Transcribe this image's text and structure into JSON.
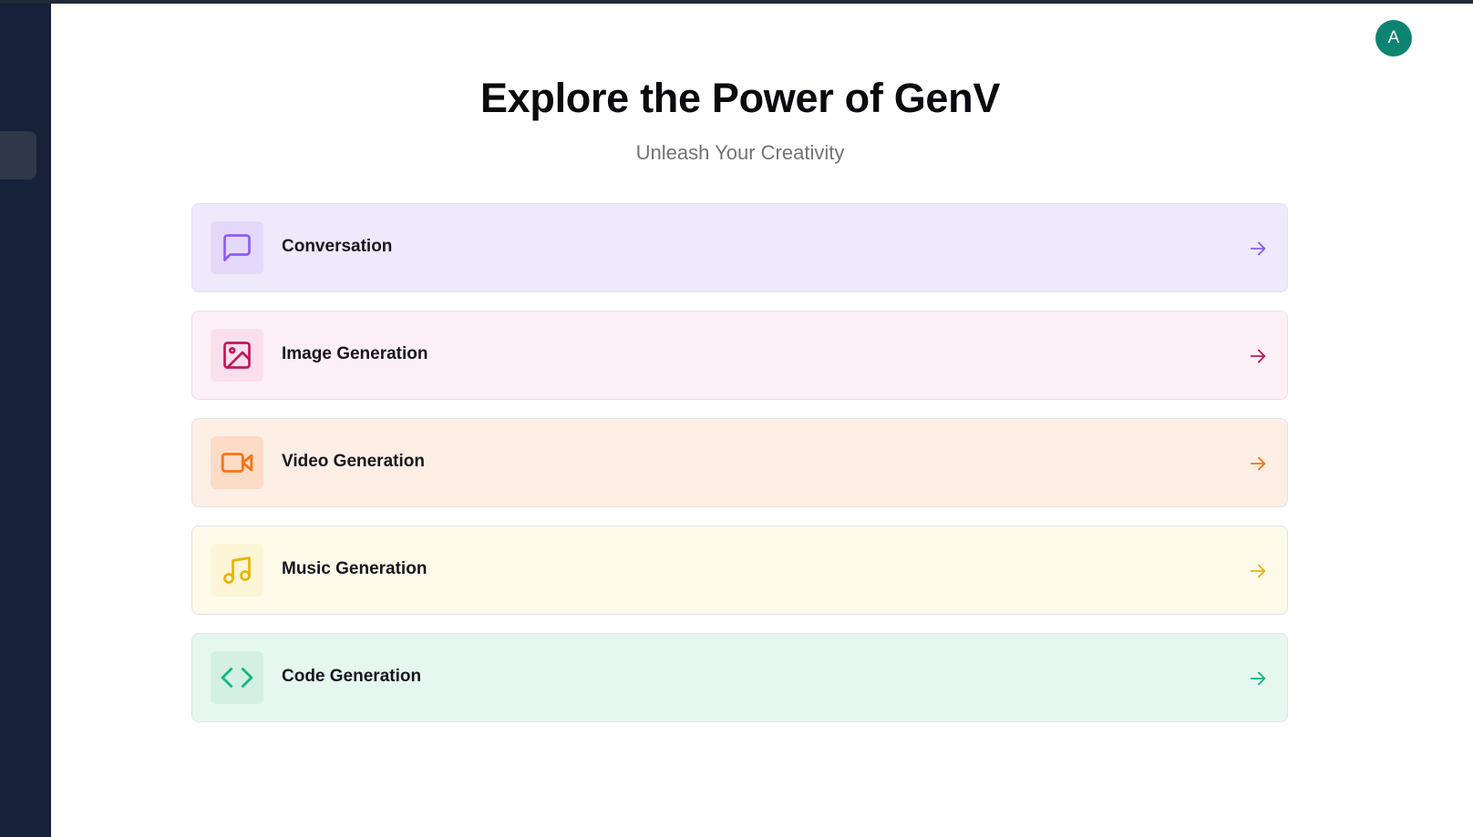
{
  "user": {
    "avatar_initial": "A",
    "avatar_color": "#0d8472"
  },
  "hero": {
    "title": "Explore the Power of GenV",
    "subtitle": "Unleash Your Creativity"
  },
  "tools": [
    {
      "label": "Conversation",
      "icon": "message-square-icon",
      "accent": "#8b5cf6"
    },
    {
      "label": "Image Generation",
      "icon": "image-icon",
      "accent": "#be185d"
    },
    {
      "label": "Video Generation",
      "icon": "video-icon",
      "accent": "#f97316"
    },
    {
      "label": "Music Generation",
      "icon": "music-icon",
      "accent": "#eab308"
    },
    {
      "label": "Code Generation",
      "icon": "code-icon",
      "accent": "#10b981"
    }
  ]
}
